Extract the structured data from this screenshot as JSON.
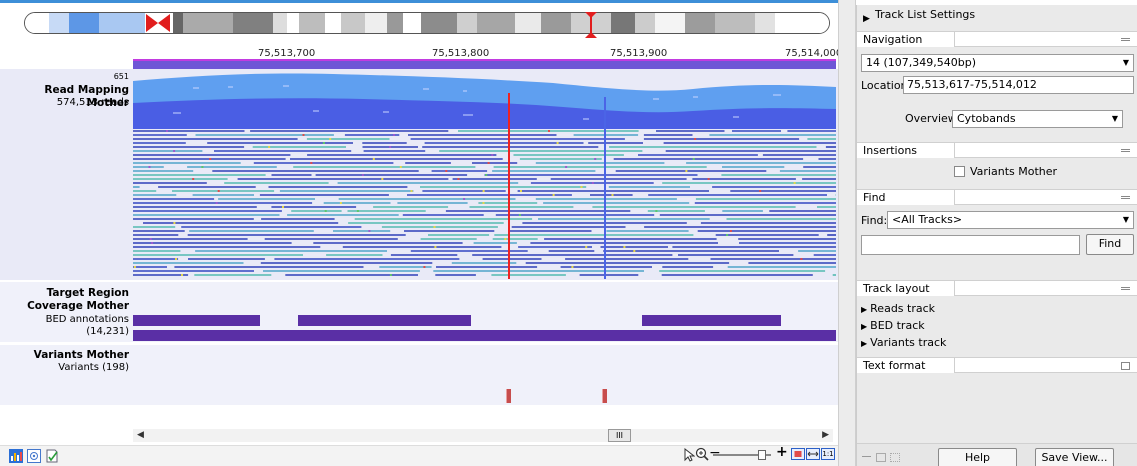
{
  "ruler": {
    "ticks": [
      "75,513,700",
      "75,513,800",
      "75,513,900",
      "75,514,000"
    ]
  },
  "tracks": {
    "reads": {
      "max_coverage": "651",
      "title": "Read Mapping Mother",
      "count": "574,513 reads"
    },
    "bed": {
      "title_line1": "Target Region",
      "title_line2": "Coverage Mother",
      "subtitle": "BED annotations (14,231)"
    },
    "variants": {
      "title": "Variants Mother",
      "subtitle": "Variants (198)"
    }
  },
  "scrollbar": {
    "left_arrow": "◀",
    "right_arrow": "▶",
    "thumb": "III"
  },
  "bottom_toolbar": {
    "zoom_minus": "−",
    "zoom_plus": "+",
    "fit_label": "1:1"
  },
  "panel": {
    "title": "Track List Settings",
    "navigation": {
      "header": "Navigation",
      "chromosome": "14 (107,349,540bp)",
      "location_label": "Location:",
      "location_value": "75,513,617-75,514,012",
      "overview_label": "Overview",
      "overview_value": "Cytobands"
    },
    "insertions": {
      "header": "Insertions",
      "checkbox_label": "Variants Mother",
      "checked": false
    },
    "find": {
      "header": "Find",
      "find_label": "Find:",
      "scope_value": "<All Tracks>",
      "search_value": "",
      "button": "Find"
    },
    "track_layout": {
      "header": "Track layout",
      "items": [
        "Reads track",
        "BED track",
        "Variants track"
      ]
    },
    "text_format": {
      "header": "Text format"
    },
    "footer": {
      "help_button": "Help",
      "save_view_button": "Save View..."
    }
  },
  "colors": {
    "coverage_light": "#5f9ff0",
    "coverage_dark": "#4a5ee4",
    "bed": "#5a2fa5",
    "ruler": "#6e56d6",
    "variant": "#c74d4d",
    "cursor_red": "#ee2222",
    "cursor_blue": "#4b64e6"
  }
}
